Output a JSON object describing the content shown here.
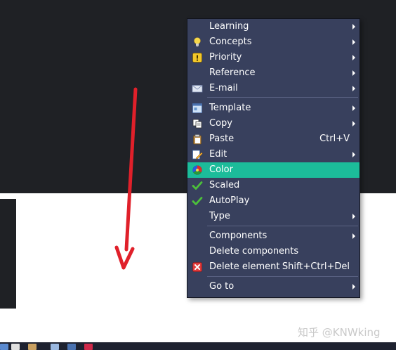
{
  "menu": {
    "items": [
      {
        "label": "Learning",
        "icon": "none",
        "submenu": true
      },
      {
        "label": "Concepts",
        "icon": "lightbulb-icon",
        "submenu": true
      },
      {
        "label": "Priority",
        "icon": "priority-icon",
        "submenu": true
      },
      {
        "label": "Reference",
        "icon": "none",
        "submenu": true
      },
      {
        "label": "E-mail",
        "icon": "envelope-icon",
        "submenu": true
      },
      {
        "label": "Template",
        "icon": "template-icon",
        "submenu": true
      },
      {
        "label": "Copy",
        "icon": "copy-icon",
        "submenu": true
      },
      {
        "label": "Paste",
        "icon": "paste-icon",
        "shortcut": "Ctrl+V",
        "submenu": false
      },
      {
        "label": "Edit",
        "icon": "edit-icon",
        "submenu": true
      },
      {
        "label": "Color",
        "icon": "color-palette-icon",
        "submenu": false,
        "highlighted": true
      },
      {
        "label": "Scaled",
        "icon": "checkmark-icon",
        "checked": true,
        "submenu": false
      },
      {
        "label": "AutoPlay",
        "icon": "checkmark-icon",
        "checked": true,
        "submenu": false
      },
      {
        "label": "Type",
        "icon": "none",
        "submenu": true
      },
      {
        "label": "Components",
        "icon": "none",
        "submenu": true
      },
      {
        "label": "Delete components",
        "icon": "none",
        "submenu": false
      },
      {
        "label": "Delete element",
        "icon": "delete-icon",
        "shortcut": "Shift+Ctrl+Del",
        "submenu": false
      },
      {
        "label": "Go to",
        "icon": "none",
        "submenu": true
      }
    ]
  },
  "watermark": "知乎 @KNWking",
  "colors": {
    "menu_bg": "#38405d",
    "highlight": "#1cbc9a",
    "arrow": "#e0202a",
    "dark_bg": "#1f2125"
  }
}
